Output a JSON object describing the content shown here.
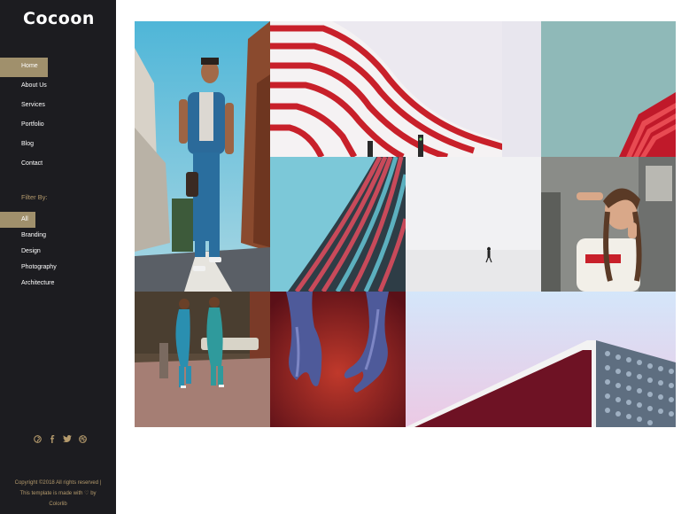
{
  "brand": {
    "logo": "Cocoon"
  },
  "nav": {
    "items": [
      {
        "label": "Home",
        "active": true
      },
      {
        "label": "About Us",
        "active": false
      },
      {
        "label": "Services",
        "active": false
      },
      {
        "label": "Portfolio",
        "active": false
      },
      {
        "label": "Blog",
        "active": false
      },
      {
        "label": "Contact",
        "active": false
      }
    ]
  },
  "filter": {
    "title": "Filter By:",
    "items": [
      {
        "label": "All",
        "active": true
      },
      {
        "label": "Branding",
        "active": false
      },
      {
        "label": "Design",
        "active": false
      },
      {
        "label": "Photography",
        "active": false
      },
      {
        "label": "Architecture",
        "active": false
      }
    ]
  },
  "social": {
    "icons": [
      "pinterest-icon",
      "facebook-icon",
      "twitter-icon",
      "dribbble-icon"
    ]
  },
  "footer": {
    "line1": "Copyright ©2018 All rights reserved |",
    "line2": "This template is made with ♡ by",
    "line3": "Colorlib"
  },
  "colors": {
    "sidebar": "#1c1c20",
    "accent": "#a0906c",
    "accent_text": "#b49a6c"
  }
}
